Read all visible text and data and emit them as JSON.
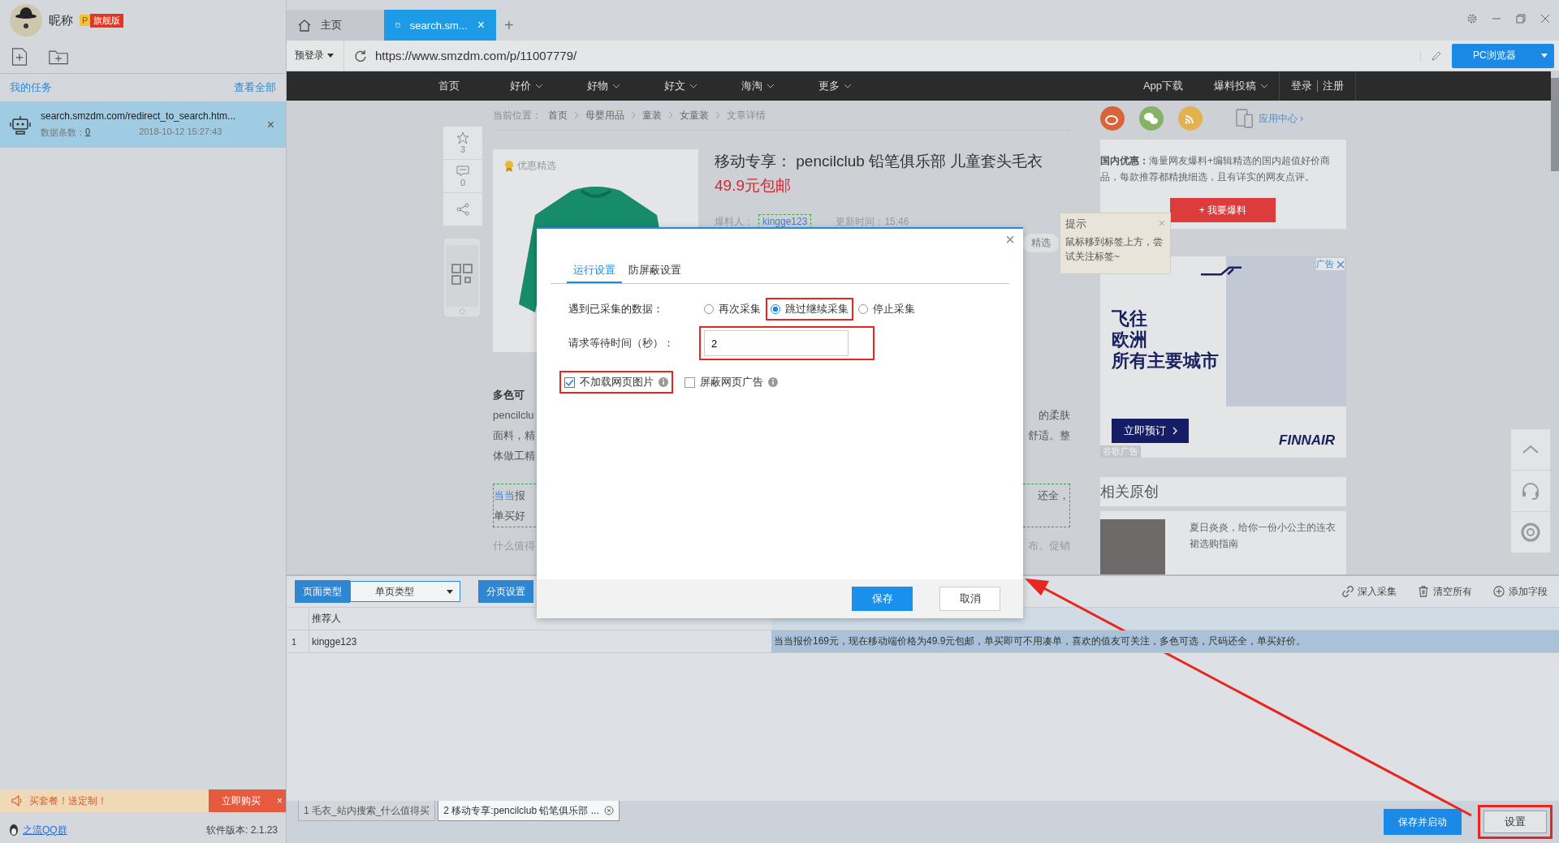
{
  "user": {
    "nickname": "昵称",
    "badge_letter": "P",
    "badge": "旗舰版"
  },
  "sidebar": {
    "section_title": "我的任务",
    "view_all": "查看全部",
    "tasks": [
      {
        "url": "search.smzdm.com/redirect_to_search.htm...",
        "count_label": "数据条数：",
        "count": "0",
        "time": "2018-10-12 15:27:43",
        "selected": true,
        "close": "×"
      }
    ],
    "promo": {
      "text": "买套餐！送定制！",
      "button": "立即购买",
      "close": "×"
    },
    "qq_group": "之流QQ群",
    "version": "软件版本: 2.1.23"
  },
  "browser_tabs": [
    {
      "label": "主页",
      "kind": "home",
      "selected": false
    },
    {
      "label": "search.sm...",
      "kind": "page",
      "selected": true,
      "close": "×"
    }
  ],
  "new_tab": "+",
  "address_bar": {
    "login_menu": "预登录",
    "url": "https://www.smzdm.com/p/11007779/",
    "mode_button": "PC浏览器"
  },
  "webpage": {
    "nav": [
      {
        "label": "首页",
        "dropdown": false
      },
      {
        "label": "好价",
        "dropdown": true
      },
      {
        "label": "好物",
        "dropdown": true
      },
      {
        "label": "好文",
        "dropdown": true
      },
      {
        "label": "海淘",
        "dropdown": true
      },
      {
        "label": "更多",
        "dropdown": true
      }
    ],
    "nav_right": [
      {
        "label": "App下载",
        "dropdown": false
      },
      {
        "label": "爆料投稿",
        "dropdown": true
      }
    ],
    "login": "登录",
    "register": "注册",
    "breadcrumb_label": "当前位置：",
    "breadcrumb": [
      "首页",
      "母婴用品",
      "童装",
      "女童装",
      "文章详情"
    ],
    "side_actions": [
      {
        "kind": "star",
        "count": "3"
      },
      {
        "kind": "comment",
        "count": "0"
      },
      {
        "kind": "share"
      }
    ],
    "image_badge": "优惠精选",
    "title": "移动专享： pencilclub 铅笔俱乐部 儿童套头毛衣",
    "price": "49.9元包邮",
    "author_label": "爆料人：",
    "author": "kingge123",
    "update": "更新时间：15:46",
    "tag": "精选",
    "article_lines": [
      {
        "kind": "heading",
        "left": "多色可"
      },
      {
        "kind": "text",
        "left": "pencilclu",
        "right": "的柔肤"
      },
      {
        "kind": "text",
        "left": "面料，精",
        "right": "舒适。整"
      },
      {
        "kind": "text",
        "left": "体做工精"
      }
    ],
    "quote_lines": [
      {
        "left": "**当当**报",
        "right": "还全，"
      },
      {
        "left": "单买好"
      }
    ],
    "footer_left": "什么值得",
    "footer_right": "布。促销",
    "app_center": "应用中心 ›",
    "info": "**国内优惠：**海量网友爆料+编辑精选的国内超值好价商品，每款推荐都精挑细选，且有详实的网友点评。",
    "report_button": "+ 我要爆料",
    "ad": {
      "headline": [
        "飞往",
        "欧洲",
        "所有主要城市"
      ],
      "button": "立即预订",
      "brand": "FINNAIR",
      "tag": "广告",
      "source": "谷歌广告"
    },
    "related_title": "相关原创",
    "related": [
      {
        "text": "夏日炎炎，给你一份小公主的连衣裙选购指南"
      }
    ],
    "tooltip": {
      "title": "提示",
      "text": "鼠标移到标签上方，尝试关注标签~",
      "close": "×"
    }
  },
  "dialog": {
    "close": "×",
    "tabs": [
      {
        "label": "运行设置",
        "selected": true
      },
      {
        "label": "防屏蔽设置",
        "selected": false
      }
    ],
    "duplicate_label": "遇到已采集的数据：",
    "duplicate_options": [
      {
        "label": "再次采集",
        "selected": false,
        "highlighted": false
      },
      {
        "label": "跳过继续采集",
        "selected": true,
        "highlighted": true
      },
      {
        "label": "停止采集",
        "selected": false,
        "highlighted": false
      }
    ],
    "wait_label": "请求等待时间（秒）：",
    "wait_value": "2",
    "wait_highlighted": true,
    "options": [
      {
        "label": "不加载网页图片",
        "checked": true,
        "highlighted": true
      },
      {
        "label": "屏蔽网页广告",
        "checked": false,
        "highlighted": false
      }
    ],
    "save": "保存",
    "cancel": "取消"
  },
  "collector": {
    "page_type_label": "页面类型",
    "page_type": "单页类型",
    "pagination": "分页设置",
    "actions": [
      {
        "kind": "link",
        "label": "深入采集"
      },
      {
        "kind": "trash",
        "label": "清空所有"
      },
      {
        "kind": "add",
        "label": "添加字段"
      }
    ],
    "columns": [
      "推荐人"
    ],
    "rows": [
      {
        "index": "1",
        "cells": [
          "kingge123",
          "当当报价169元，现在移动端价格为49.9元包邮，单买即可不用凑单，喜欢的值友可关注，多色可选，尺码还全，单买好价。"
        ],
        "selected": true
      }
    ]
  },
  "bottom_bar": {
    "tasks": [
      {
        "label": "1 毛衣_站内搜索_什么值得买",
        "selected": false,
        "closable": false
      },
      {
        "label": "2 移动专享:pencilclub 铅笔俱乐部 ...",
        "selected": true,
        "closable": true
      }
    ],
    "save_start": "保存并启动",
    "settings": "设置",
    "settings_highlighted": true
  },
  "annotation": {
    "arrow": true
  }
}
